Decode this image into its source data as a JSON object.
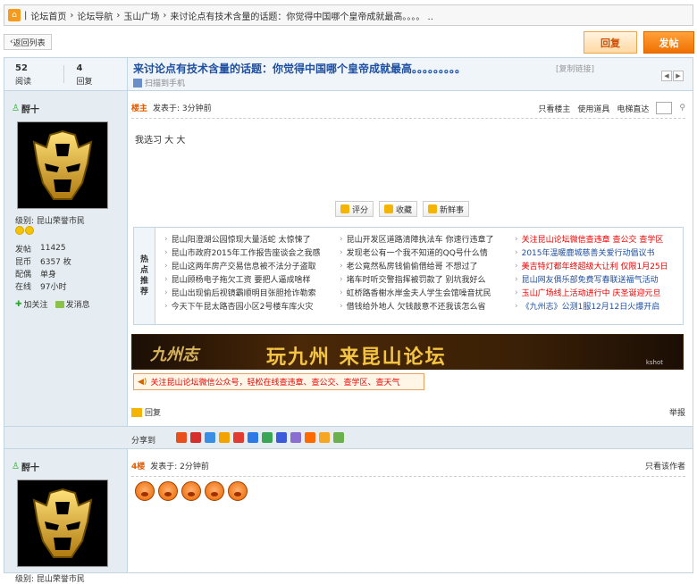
{
  "breadcrumb": {
    "items": [
      "论坛首页",
      "论坛导航",
      "玉山广场",
      "来讨论点有技术含量的话题：你觉得中国哪个皇帝成就最高。。。。 .."
    ]
  },
  "toolbar": {
    "back_label": "返回列表",
    "reply_label": "回复",
    "post_label": "发帖"
  },
  "thread": {
    "views": "52",
    "views_label": "阅读",
    "replies": "4",
    "replies_label": "回复",
    "title": "来讨论点有技术含量的话题：你觉得中国哪个皇帝成就最高。。。。。。。。。",
    "copy_link": "[复制链接]",
    "scan_mobile": "扫描到手机"
  },
  "post1": {
    "author": "酹十",
    "level": "级别: 昆山荣誉市民",
    "stats": [
      {
        "k": "发帖",
        "v": "11425"
      },
      {
        "k": "昆币",
        "v": "6357 枚"
      },
      {
        "k": "配偶",
        "v": "单身"
      },
      {
        "k": "在线",
        "v": "97小时"
      }
    ],
    "follow_label": "加关注",
    "message_label": "发消息",
    "floor": "楼主",
    "posted": "发表于: 3分钟前",
    "only_op": "只看楼主",
    "use_tool": "使用道具",
    "floor_jump": "电梯直达",
    "content": "我选习 大 大",
    "rate_label": "评分",
    "fav_label": "收藏",
    "fresh_label": "新鲜事",
    "hot_label": "热点推荐",
    "hot_col1": [
      "昆山阳澄湖公园惊现大量活蛇 太惊悚了",
      "昆山市政府2015年工作报告座谈会之我感",
      "昆山这两年房产交易信息被不法分子盗取",
      "昆山顾杨电子拖欠工资 要把人逼成啥样",
      "昆山出现偷后视镜霸顺明目张胆抢诈勒索",
      "今天下午昆太路杏园小区2号楼车库火灾"
    ],
    "hot_col2": [
      "昆山开发区道路清障执法车 你速行违章了",
      "发现老公有一个我不知道的QQ号什么情",
      "老公竟然私房钱偷偷借给哥 不想过了",
      "堵车时听交警指挥被罚款了 别坑我好么",
      "虹桥路香榭水岸金夫人学生会馆噪音扰民",
      "借钱给外地人 欠钱敲意不还我该怎么省"
    ],
    "hot_col3": [
      "关注昆山论坛微信查违章 查公交 查学区",
      "2015年温暖鹿城慈善关爱行动倡议书",
      "美吉特灯都年终超级大让利 仅限1月25日",
      "昆山网友俱乐部免费写春联送福气活动",
      "玉山广场线上活动进行中 庆圣诞迎元旦",
      "《九州志》公测1服12月12日火爆开启"
    ],
    "banner_logo": "九州志",
    "banner_slogan": "玩九州  来昆山论坛",
    "banner_tag": "kshot",
    "notice": "关注昆山论坛微信公众号，轻松在线查违章、查公交、查学区、查天气",
    "reply_label": "回复",
    "report_label": "举报"
  },
  "share": {
    "label": "分享到",
    "icon_colors": [
      "#e94e1b",
      "#d62d2d",
      "#3a8ee6",
      "#f2a300",
      "#e03c31",
      "#2c7be5",
      "#3aa655",
      "#3b5bdb",
      "#8a6fd1",
      "#ff6a00",
      "#f5a623",
      "#6ab04c"
    ]
  },
  "post2": {
    "author": "酹十",
    "level": "级别: 昆山荣誉市民",
    "floor": "4楼",
    "posted": "发表于: 2分钟前",
    "only_author": "只看该作者"
  }
}
